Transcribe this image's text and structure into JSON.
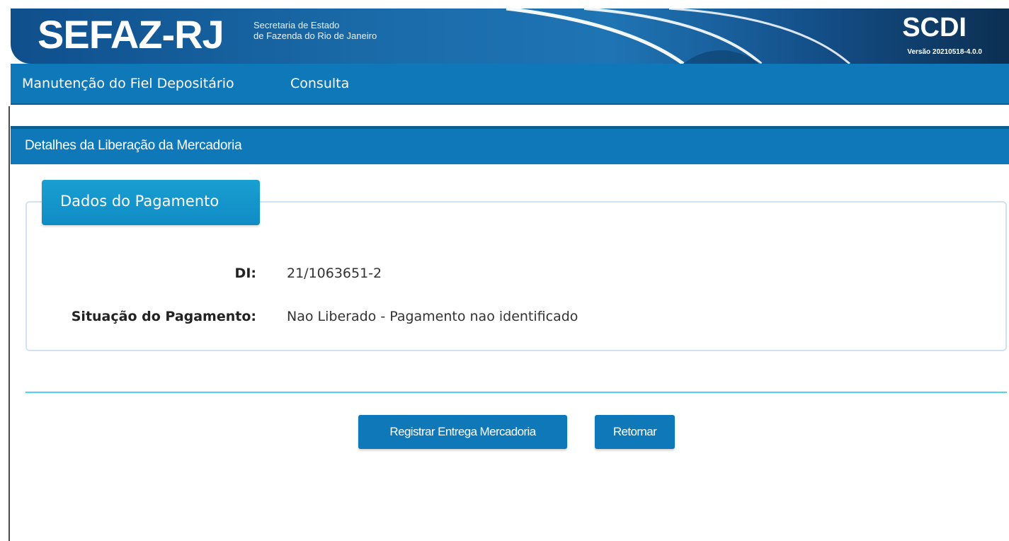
{
  "header": {
    "logo": "SEFAZ-RJ",
    "logo_sub_line1": "Secretaria de Estado",
    "logo_sub_line2": "de Fazenda do Rio de Janeiro",
    "system_name": "SCDI",
    "version": "Versão 20210518-4.0.0"
  },
  "menu": {
    "items": [
      {
        "label": "Manutenção do Fiel Depositário"
      },
      {
        "label": "Consulta"
      }
    ]
  },
  "panel": {
    "title": "Detalhes da Liberação da Mercadoria",
    "section": {
      "legend": "Dados do Pagamento",
      "fields": [
        {
          "label": "DI:",
          "value": "21/1063651-2"
        },
        {
          "label": "Situação do Pagamento:",
          "value": "Nao Liberado - Pagamento nao identificado"
        }
      ]
    }
  },
  "actions": {
    "register_label": "Registrar Entrega Mercadoria",
    "return_label": "Retornar"
  },
  "colors": {
    "primary": "#0e78b8",
    "legend": "#1a9fd2",
    "divider": "#4fd2f0",
    "banner_dark": "#0c2f52"
  }
}
